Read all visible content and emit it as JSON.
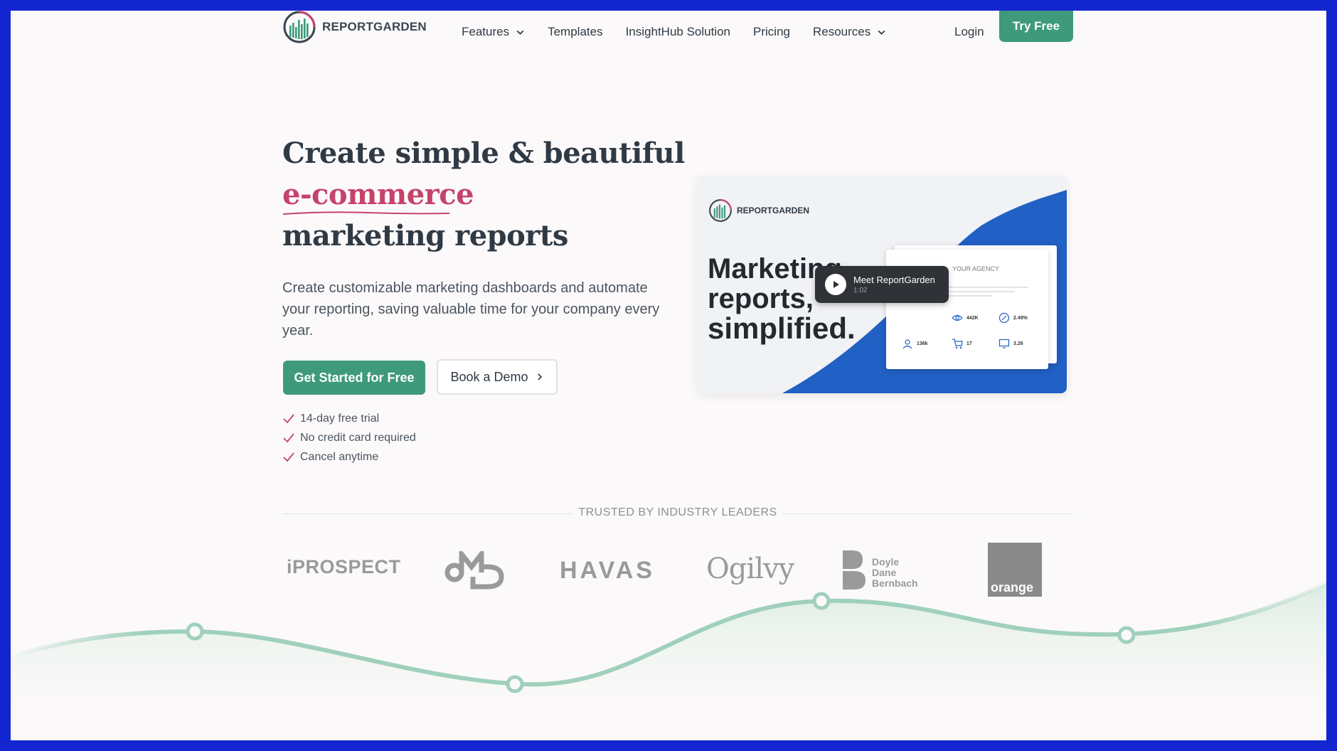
{
  "nav": {
    "logo_text": "REPORTGARDEN",
    "items": [
      {
        "label": "Features",
        "has_dropdown": true
      },
      {
        "label": "Templates",
        "has_dropdown": false
      },
      {
        "label": "InsightHub Solution",
        "has_dropdown": false
      },
      {
        "label": "Pricing",
        "has_dropdown": false
      },
      {
        "label": "Resources",
        "has_dropdown": true
      }
    ],
    "login_label": "Login",
    "try_label": "Try Free"
  },
  "hero": {
    "title_line1": "Create simple & beautiful",
    "title_accent": "e-commerce",
    "title_line3": "marketing reports",
    "subtitle": "Create customizable marketing dashboards and automate your reporting, saving valuable time for your company every year.",
    "primary_cta": "Get Started for Free",
    "secondary_cta": "Book a Demo",
    "checks": [
      "14-day free trial",
      "No credit card required",
      "Cancel anytime"
    ]
  },
  "video": {
    "logo_text": "REPORTGARDEN",
    "headline_1": "Marketing",
    "headline_2": "reports,",
    "headline_3": "simplified.",
    "play_title": "Meet ReportGarden",
    "play_duration": "1:02",
    "doc_header": "YOUR AGENCY",
    "stats": [
      "442K",
      "2.49%",
      "136k",
      "17",
      "3.26"
    ]
  },
  "trusted": {
    "label": "TRUSTED BY INDUSTRY LEADERS",
    "brands": {
      "iprospect": "iPROSPECT",
      "havas": "HAVAS",
      "ogilvy": "Ogilvy",
      "ddb_1": "Doyle",
      "ddb_2": "Dane",
      "ddb_3": "Bernbach",
      "orange": "orange"
    }
  },
  "colors": {
    "brand_green": "#3e9a7a",
    "accent_pink": "#c5436b",
    "text_dark": "#2f3a44",
    "video_blue": "#2160c4",
    "curve_green": "#9fd0bc",
    "frame_blue": "#1326d0"
  }
}
